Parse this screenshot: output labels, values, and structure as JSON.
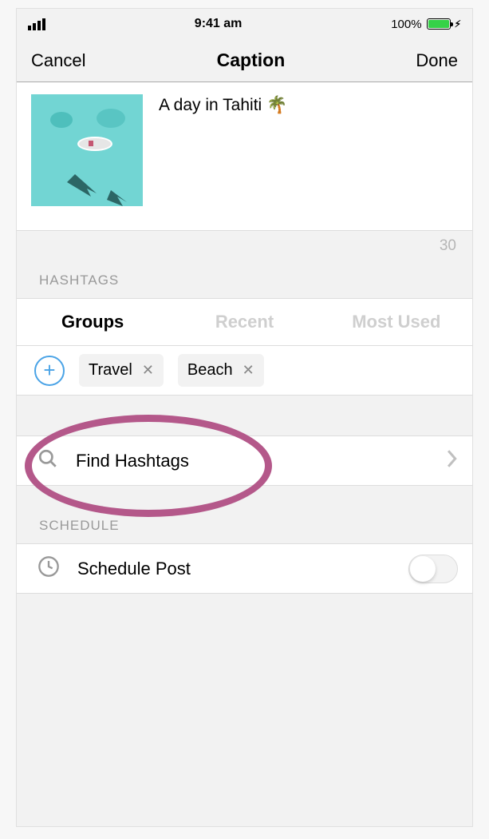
{
  "status": {
    "time": "9:41 am",
    "battery_pct": "100%"
  },
  "nav": {
    "cancel": "Cancel",
    "title": "Caption",
    "done": "Done"
  },
  "caption": {
    "text": "A day in Tahiti 🌴"
  },
  "char_count": "30",
  "sections": {
    "hashtags": "HASHTAGS",
    "schedule": "SCHEDULE"
  },
  "tabs": {
    "groups": "Groups",
    "recent": "Recent",
    "most_used": "Most Used"
  },
  "chips": [
    {
      "label": "Travel"
    },
    {
      "label": "Beach"
    }
  ],
  "find_hashtags": "Find Hashtags",
  "schedule_post": "Schedule Post"
}
